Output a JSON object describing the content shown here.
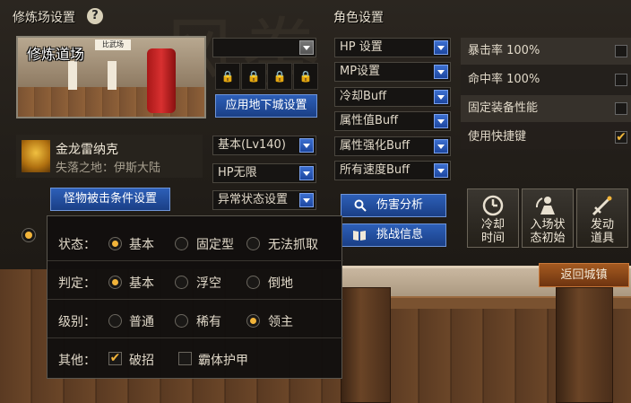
{
  "left_panel": {
    "title": "修炼场设置",
    "scene_name": "修炼道场",
    "scene_sign": "比武场",
    "apply_button": "应用地下城设置",
    "empty_dropdown": "",
    "lock_glyph": "🔒",
    "monster": {
      "name": "金龙雷纳克",
      "location": "失落之地：伊斯大陆"
    },
    "level_dropdown": "基本(Lv140)",
    "hp_dropdown": "HP无限",
    "status_dropdown": "异常状态设置",
    "condition_button": "怪物被击条件设置"
  },
  "role_panel": {
    "title": "角色设置",
    "dropdowns": [
      "HP 设置",
      "MP设置",
      "冷却Buff",
      "属性值Buff",
      "属性强化Buff",
      "所有速度Buff"
    ],
    "damage_button": "伤害分析",
    "challenge_button": "挑战信息"
  },
  "stats": [
    {
      "label": "暴击率 100%",
      "checked": false
    },
    {
      "label": "命中率 100%",
      "checked": false
    },
    {
      "label": "固定装备性能",
      "checked": false
    },
    {
      "label": "使用快捷键",
      "checked": true
    }
  ],
  "check_mark": "✔",
  "action_buttons": [
    {
      "label1": "冷却",
      "label2": "时间",
      "icon": "clock-icon"
    },
    {
      "label1": "入场状",
      "label2": "态初始",
      "icon": "reset-icon"
    },
    {
      "label1": "发动",
      "label2": "道具",
      "icon": "sword-icon"
    }
  ],
  "return_button": "返回城镇",
  "popup": {
    "rows": [
      {
        "label": "状态：",
        "options": [
          "基本",
          "固定型",
          "无法抓取"
        ],
        "selected": 0
      },
      {
        "label": "判定：",
        "options": [
          "基本",
          "浮空",
          "倒地"
        ],
        "selected": 0
      },
      {
        "label": "级别：",
        "options": [
          "普通",
          "稀有",
          "领主"
        ],
        "selected": 2
      }
    ],
    "other": {
      "label": "其他：",
      "options": [
        {
          "label": "破招",
          "checked": true
        },
        {
          "label": "霸体护甲",
          "checked": false
        }
      ]
    }
  },
  "colors": {
    "accent": "#f2b43a",
    "button_blue": "#2d5fb8",
    "return_button": "#8a4a18"
  }
}
